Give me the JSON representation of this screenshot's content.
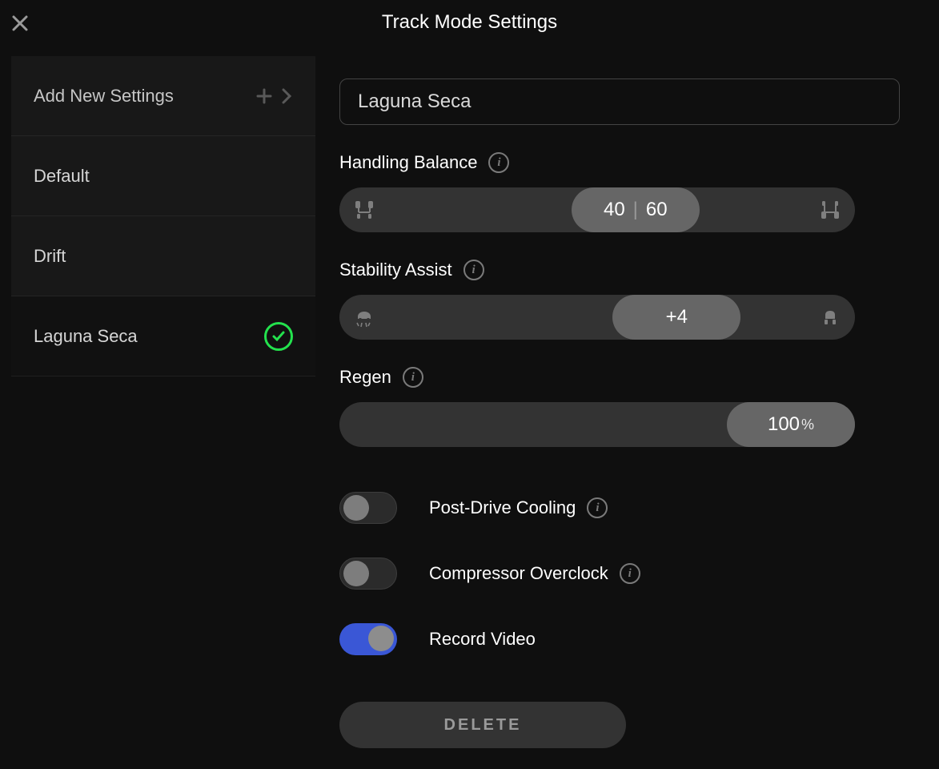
{
  "title": "Track Mode Settings",
  "sidebar": {
    "add": {
      "label": "Add New Settings"
    },
    "items": [
      {
        "label": "Default",
        "selected": false
      },
      {
        "label": "Drift",
        "selected": false
      },
      {
        "label": "Laguna Seca",
        "selected": true
      }
    ]
  },
  "profile": {
    "name": "Laguna Seca",
    "handling": {
      "label": "Handling Balance",
      "front": "40",
      "rear": "60",
      "thumb_position_pct": 45
    },
    "stability": {
      "label": "Stability Assist",
      "value": "+4",
      "thumb_position_pct": 53
    },
    "regen": {
      "label": "Regen",
      "value": "100",
      "unit": "%"
    },
    "toggles": {
      "post_drive_cooling": {
        "label": "Post-Drive Cooling",
        "on": false,
        "has_info": true
      },
      "compressor_overclock": {
        "label": "Compressor Overclock",
        "on": false,
        "has_info": true
      },
      "record_video": {
        "label": "Record Video",
        "on": true,
        "has_info": false
      }
    },
    "delete_label": "DELETE"
  }
}
